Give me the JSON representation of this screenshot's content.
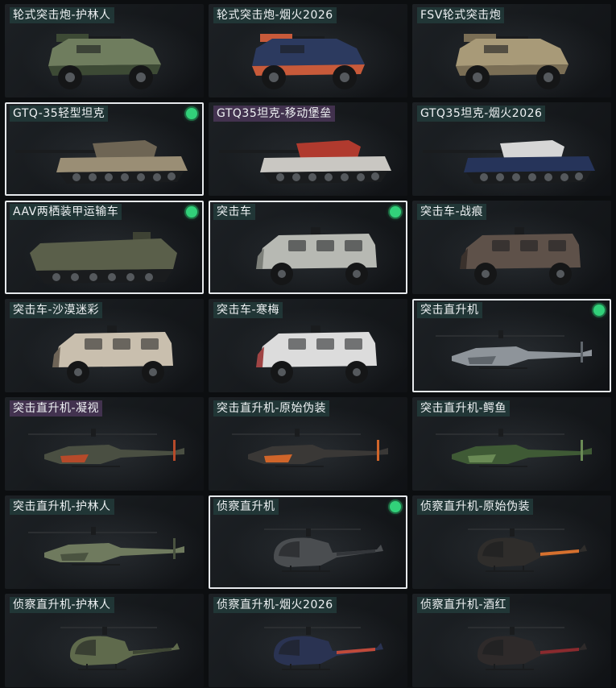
{
  "vehicles": [
    {
      "label": "轮式突击炮-护林人",
      "kind": "wheeled-gun",
      "camo": "#6f7d5e",
      "accent": "#3d4a35",
      "selected": false,
      "equipped": false,
      "rare": false
    },
    {
      "label": "轮式突击炮-烟火2026",
      "kind": "wheeled-gun",
      "camo": "#2c3a5f",
      "accent": "#c85a3a",
      "selected": false,
      "equipped": false,
      "rare": false
    },
    {
      "label": "FSV轮式突击炮",
      "kind": "wheeled-gun",
      "camo": "#a89a78",
      "accent": "#7a6e55",
      "selected": false,
      "equipped": false,
      "rare": false
    },
    {
      "label": "GTQ-35轻型坦克",
      "kind": "tank",
      "camo": "#9a8e75",
      "accent": "#6e6554",
      "selected": true,
      "equipped": true,
      "rare": false
    },
    {
      "label": "GTQ35坦克-移动堡垒",
      "kind": "tank",
      "camo": "#c9c7c2",
      "accent": "#b03a2e",
      "selected": false,
      "equipped": false,
      "rare": true
    },
    {
      "label": "GTQ35坦克-烟火2026",
      "kind": "tank",
      "camo": "#26345a",
      "accent": "#d6d6d6",
      "selected": false,
      "equipped": false,
      "rare": false
    },
    {
      "label": "AAV两栖装甲运输车",
      "kind": "amphibious",
      "camo": "#5a5f4a",
      "accent": "#3e4234",
      "selected": true,
      "equipped": true,
      "rare": false
    },
    {
      "label": "突击车",
      "kind": "armored-car",
      "camo": "#b7b9b3",
      "accent": "#7d807a",
      "selected": true,
      "equipped": true,
      "rare": false
    },
    {
      "label": "突击车-战痕",
      "kind": "armored-car",
      "camo": "#5e5149",
      "accent": "#3a312c",
      "selected": false,
      "equipped": false,
      "rare": false
    },
    {
      "label": "突击车-沙漠迷彩",
      "kind": "armored-car",
      "camo": "#c9bfae",
      "accent": "#6e6457",
      "selected": false,
      "equipped": false,
      "rare": false
    },
    {
      "label": "突击车-寒梅",
      "kind": "armored-car",
      "camo": "#dcdcdc",
      "accent": "#a04444",
      "selected": false,
      "equipped": false,
      "rare": false
    },
    {
      "label": "突击直升机",
      "kind": "attack-heli",
      "camo": "#8e949a",
      "accent": "#5f656b",
      "selected": true,
      "equipped": true,
      "rare": false
    },
    {
      "label": "突击直升机-凝视",
      "kind": "attack-heli",
      "camo": "#4a4f42",
      "accent": "#b64a2a",
      "selected": false,
      "equipped": false,
      "rare": true
    },
    {
      "label": "突击直升机-原始伪装",
      "kind": "attack-heli",
      "camo": "#3a3836",
      "accent": "#d0652a",
      "selected": false,
      "equipped": false,
      "rare": false
    },
    {
      "label": "突击直升机-鳄鱼",
      "kind": "attack-heli",
      "camo": "#3f5a35",
      "accent": "#6a8a55",
      "selected": false,
      "equipped": false,
      "rare": false
    },
    {
      "label": "突击直升机-护林人",
      "kind": "attack-heli",
      "camo": "#6f7a5e",
      "accent": "#4a5340",
      "selected": false,
      "equipped": false,
      "rare": false
    },
    {
      "label": "侦察直升机",
      "kind": "scout-heli",
      "camo": "#4a4d50",
      "accent": "#33363a",
      "selected": true,
      "equipped": true,
      "rare": false
    },
    {
      "label": "侦察直升机-原始伪装",
      "kind": "scout-heli",
      "camo": "#2f2d2b",
      "accent": "#d6702e",
      "selected": false,
      "equipped": false,
      "rare": false
    },
    {
      "label": "侦察直升机-护林人",
      "kind": "scout-heli",
      "camo": "#5f6a4c",
      "accent": "#3e4634",
      "selected": false,
      "equipped": false,
      "rare": false
    },
    {
      "label": "侦察直升机-烟火2026",
      "kind": "scout-heli",
      "camo": "#2a3352",
      "accent": "#c04a3a",
      "selected": false,
      "equipped": false,
      "rare": false
    },
    {
      "label": "侦察直升机-酒红",
      "kind": "scout-heli",
      "camo": "#2e2a2a",
      "accent": "#8a2a2e",
      "selected": false,
      "equipped": false,
      "rare": false
    }
  ]
}
